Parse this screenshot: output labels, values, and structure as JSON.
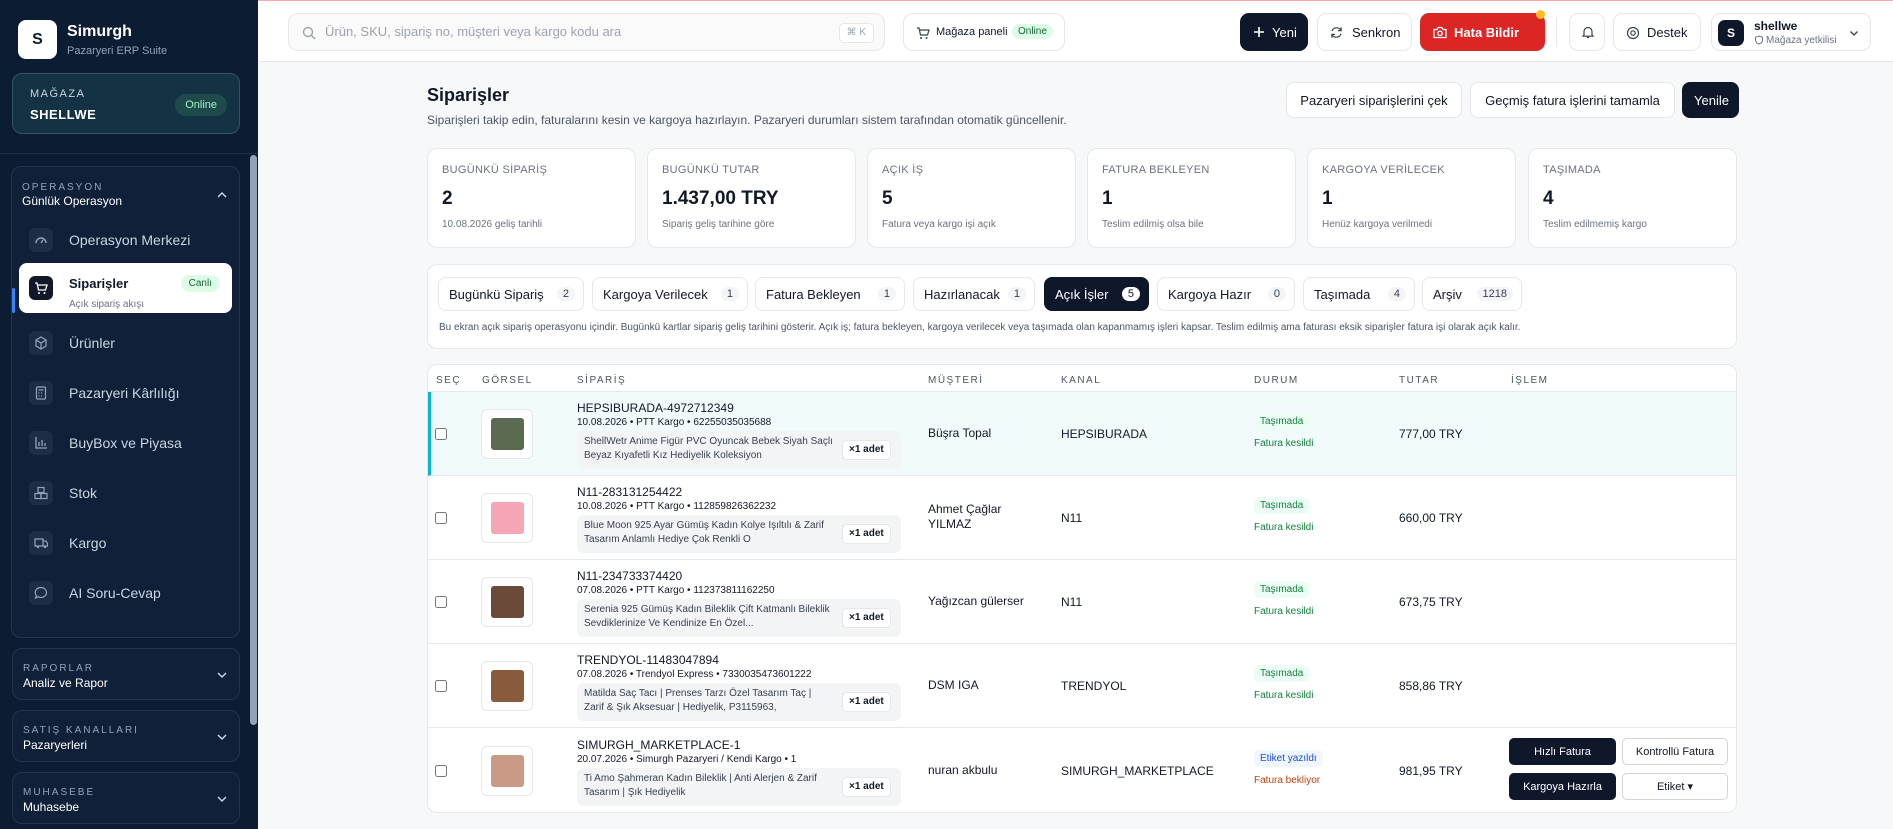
{
  "app": {
    "logo_letter": "S",
    "name": "Simurgh",
    "subtitle": "Pazaryeri ERP Suite"
  },
  "store": {
    "label": "MAĞAZA",
    "name": "SHELLWE",
    "status": "Online"
  },
  "sidebar": {
    "group": {
      "title": "OPERASYON",
      "subtitle": "Günlük Operasyon"
    },
    "items": [
      {
        "label": "Operasyon Merkezi",
        "icon": "gauge-icon"
      },
      {
        "label": "Siparişler",
        "sub": "Açık sipariş akışı",
        "badge": "Canlı",
        "icon": "shopping-cart-icon"
      },
      {
        "label": "Ürünler",
        "icon": "package-icon"
      },
      {
        "label": "Pazaryeri Kârlılığı",
        "icon": "calculator-icon"
      },
      {
        "label": "BuyBox ve Piyasa",
        "icon": "bar-chart-icon"
      },
      {
        "label": "Stok",
        "icon": "boxes-icon"
      },
      {
        "label": "Kargo",
        "icon": "truck-icon"
      },
      {
        "label": "AI Soru-Cevap",
        "icon": "chat-icon"
      }
    ],
    "sections": [
      {
        "title": "RAPORLAR",
        "subtitle": "Analiz ve Rapor"
      },
      {
        "title": "SATIŞ KANALLARI",
        "subtitle": "Pazaryerleri"
      },
      {
        "title": "MUHASEBE",
        "subtitle": "Muhasebe"
      }
    ]
  },
  "topbar": {
    "search_placeholder": "Ürün, SKU, sipariş no, müşteri veya kargo kodu ara",
    "shortcut": "⌘ K",
    "store_panel": {
      "label": "Mağaza paneli",
      "status": "Online"
    },
    "new_label": "Yeni",
    "sync_label": "Senkron",
    "report_bug_label": "Hata Bildir",
    "support_label": "Destek",
    "user": {
      "initial": "S",
      "name": "shellwe",
      "role": "Mağaza yetkilisi"
    }
  },
  "page": {
    "title": "Siparişler",
    "description": "Siparişleri takip edin, faturalarını kesin ve kargoya hazırlayın. Pazaryeri durumları sistem tarafından otomatik güncellenir.",
    "actions": {
      "fetch": "Pazaryeri siparişlerini çek",
      "complete": "Geçmiş fatura işlerini tamamla",
      "refresh": "Yenile"
    }
  },
  "kpis": [
    {
      "label": "BUGÜNKÜ SİPARİŞ",
      "value": "2",
      "sub": "10.08.2026 geliş tarihli"
    },
    {
      "label": "BUGÜNKÜ TUTAR",
      "value": "1.437,00 TRY",
      "sub": "Sipariş geliş tarihine göre"
    },
    {
      "label": "AÇIK İŞ",
      "value": "5",
      "sub": "Fatura veya kargo işi açık"
    },
    {
      "label": "FATURA BEKLEYEN",
      "value": "1",
      "sub": "Teslim edilmiş olsa bile"
    },
    {
      "label": "KARGOYA VERİLECEK",
      "value": "1",
      "sub": "Henüz kargoya verilmedi"
    },
    {
      "label": "TAŞIMADA",
      "value": "4",
      "sub": "Teslim edilmemiş kargo"
    }
  ],
  "tabs": [
    {
      "label": "Bugünkü Sipariş",
      "count": "2"
    },
    {
      "label": "Kargoya Verilecek",
      "count": "1"
    },
    {
      "label": "Fatura Bekleyen",
      "count": "1"
    },
    {
      "label": "Hazırlanacak",
      "count": "1"
    },
    {
      "label": "Açık İşler",
      "count": "5"
    },
    {
      "label": "Kargoya Hazır",
      "count": "0"
    },
    {
      "label": "Taşımada",
      "count": "4"
    },
    {
      "label": "Arşiv",
      "count": "1218"
    }
  ],
  "tabs_note": "Bu ekran açık sipariş operasyonu içindir. Bugünkü kartlar sipariş geliş tarihini gösterir. Açık iş; fatura bekleyen, kargoya verilecek veya taşımada olan kapanmamış işleri kapsar. Teslim edilmiş ama faturası eksik siparişler fatura işi olarak açık kalır.",
  "table": {
    "columns": [
      "SEÇ",
      "GÖRSEL",
      "SİPARİŞ",
      "MÜŞTERİ",
      "KANAL",
      "DURUM",
      "TUTAR",
      "İŞLEM"
    ],
    "rows": [
      {
        "order_id": "HEPSIBURADA-4972712349",
        "meta": "10.08.2026 • PTT Kargo • 62255035035688",
        "product": "ShellWetr Anime Figür PVC Oyuncak Bebek Siyah Saçlı Beyaz Kıyafetli Kız Hediyelik Koleksiyon",
        "qty": "×1 adet",
        "customer": "Büşra Topal",
        "channel": "HEPSIBURADA",
        "status": "Taşımada",
        "invoice": "Fatura kesildi",
        "amount": "777,00 TRY",
        "thumb_color": "#5b6b52"
      },
      {
        "order_id": "N11-283131254422",
        "meta": "10.08.2026 • PTT Kargo • 112859826362232",
        "product": "Blue Moon 925 Ayar Gümüş Kadın Kolye Işıltılı & Zarif Tasarım Anlamlı Hediye Çok Renkli O",
        "qty": "×1 adet",
        "customer": "Ahmet Çağlar YILMAZ",
        "channel": "N11",
        "status": "Taşımada",
        "invoice": "Fatura kesildi",
        "amount": "660,00 TRY",
        "thumb_color": "#f4a6b4"
      },
      {
        "order_id": "N11-234733374420",
        "meta": "07.08.2026 • PTT Kargo • 112373811162250",
        "product": "Serenia 925 Gümüş Kadın Bileklik Çift Katmanlı Bileklik Sevdiklerinize Ve Kendinize En Özel...",
        "qty": "×1 adet",
        "customer": "Yağızcan gülerser",
        "channel": "N11",
        "status": "Taşımada",
        "invoice": "Fatura kesildi",
        "amount": "673,75 TRY",
        "thumb_color": "#6b4a3a"
      },
      {
        "order_id": "TRENDYOL-11483047894",
        "meta": "07.08.2026 • Trendyol Express • 7330035473601222",
        "product": "Matilda Saç Tacı | Prenses Tarzı Özel Tasarım Taç | Zarif & Şık Aksesuar | Hediyelik, P3115963,",
        "qty": "×1 adet",
        "customer": "DSM IGA",
        "channel": "TRENDYOL",
        "status": "Taşımada",
        "invoice": "Fatura kesildi",
        "amount": "858,86 TRY",
        "thumb_color": "#8a5a3c"
      },
      {
        "order_id": "SIMURGH_MARKETPLACE-1",
        "meta": "20.07.2026 • Simurgh Pazaryeri / Kendi Kargo • 1",
        "product": "Ti Amo Şahmeran Kadın Bileklik | Anti Alerjen & Zarif Tasarım | Şık Hediyelik",
        "qty": "×1 adet",
        "customer": "nuran akbulu",
        "channel": "SIMURGH_MARKETPLACE",
        "status": "Etiket yazıldı",
        "invoice": "Fatura bekliyor",
        "amount": "981,95 TRY",
        "thumb_color": "#c99a85",
        "actions": {
          "quick_invoice": "Hızlı Fatura",
          "controlled_invoice": "Kontrollü Fatura",
          "ready_cargo": "Kargoya Hazırla",
          "label": "Etiket ▾"
        }
      }
    ]
  },
  "colors": {
    "sidebar_bg": "#0c1c33",
    "accent_green": "#15803d",
    "bug_red": "#dc2626",
    "warning_orange": "#c2410c",
    "label_blue": "#1d4ed8"
  }
}
